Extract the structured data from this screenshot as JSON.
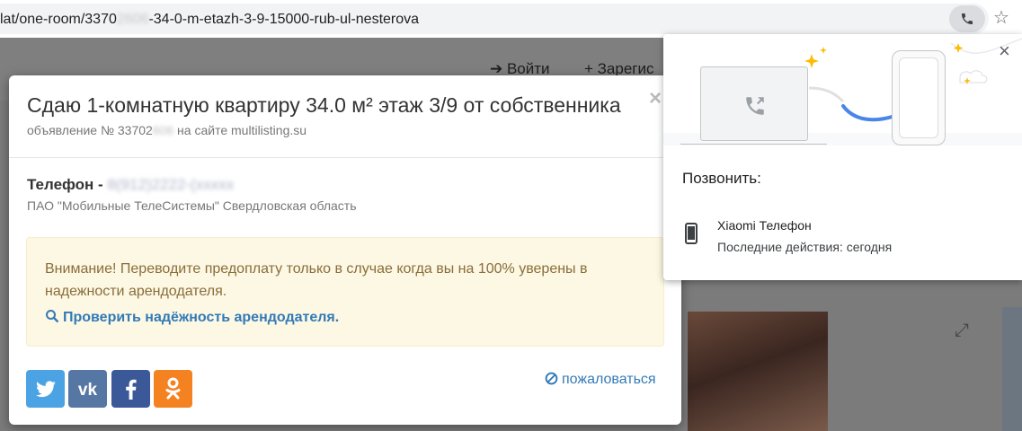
{
  "address_bar": {
    "url_prefix": "lat/one-room/3370",
    "url_blurred": "2606",
    "url_suffix": "-34-0-m-etazh-3-9-15000-rub-ul-nesterova"
  },
  "background_page": {
    "login_label": "Войти",
    "register_label": "Зарегис"
  },
  "modal": {
    "title": "Сдаю 1-комнатную квартиру 34.0 м² этаж 3/9 от собственника",
    "subtitle_prefix": "объявление № 33702",
    "subtitle_blurred": "606",
    "subtitle_suffix": " на сайте multilisting.su",
    "close_label": "×",
    "phone_label": "Телефон - ",
    "phone_blurred": "8(912)2222-(ххххх",
    "operator": "ПАО \"Мобильные ТелеСистемы\" Свердловская область",
    "alert_text": "Внимание! Переводите предоплату только в случае когда вы на 100% уверены в надежности арендодателя.",
    "alert_link": "Проверить надёжность арендодателя.",
    "report_label": "пожаловаться",
    "social": [
      "twitter",
      "vk",
      "facebook",
      "odnoklassniki"
    ]
  },
  "popup": {
    "heading": "Позвонить:",
    "device_name": "Xiaomi Телефон",
    "device_status": "Последние действия: сегодня",
    "close_label": "×"
  },
  "colors": {
    "alert_bg": "#fcf8e3",
    "alert_text": "#8a6d3b",
    "link": "#337ab7",
    "twitter": "#4ba3e3",
    "vk": "#5677a3",
    "facebook": "#3b5998",
    "ok": "#f58220"
  }
}
